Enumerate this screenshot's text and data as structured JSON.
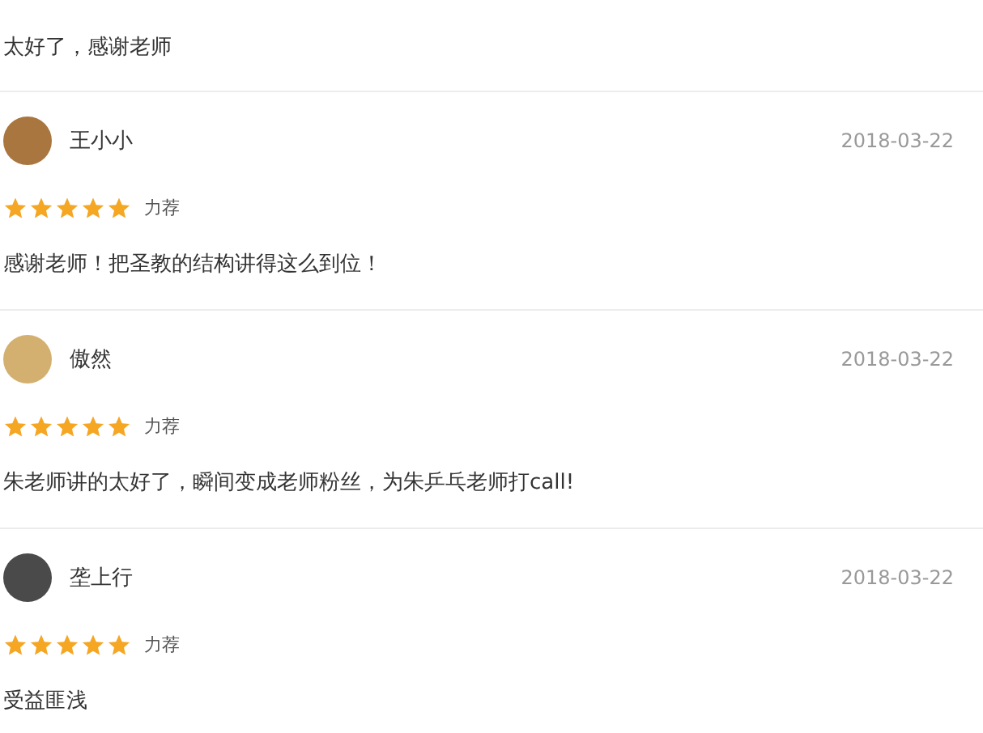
{
  "top_comment": "太好了，感谢老师",
  "reviews": [
    {
      "name": "王小小",
      "date": "2018-03-22",
      "stars": 5,
      "tag": "力荐",
      "comment": "感谢老师！把圣教的结构讲得这么到位！"
    },
    {
      "name": "傲然",
      "date": "2018-03-22",
      "stars": 5,
      "tag": "力荐",
      "comment": "朱老师讲的太好了，瞬间变成老师粉丝，为朱乒乓老师打call!"
    },
    {
      "name": "垄上行",
      "date": "2018-03-22",
      "stars": 5,
      "tag": "力荐",
      "comment": "受益匪浅"
    }
  ]
}
